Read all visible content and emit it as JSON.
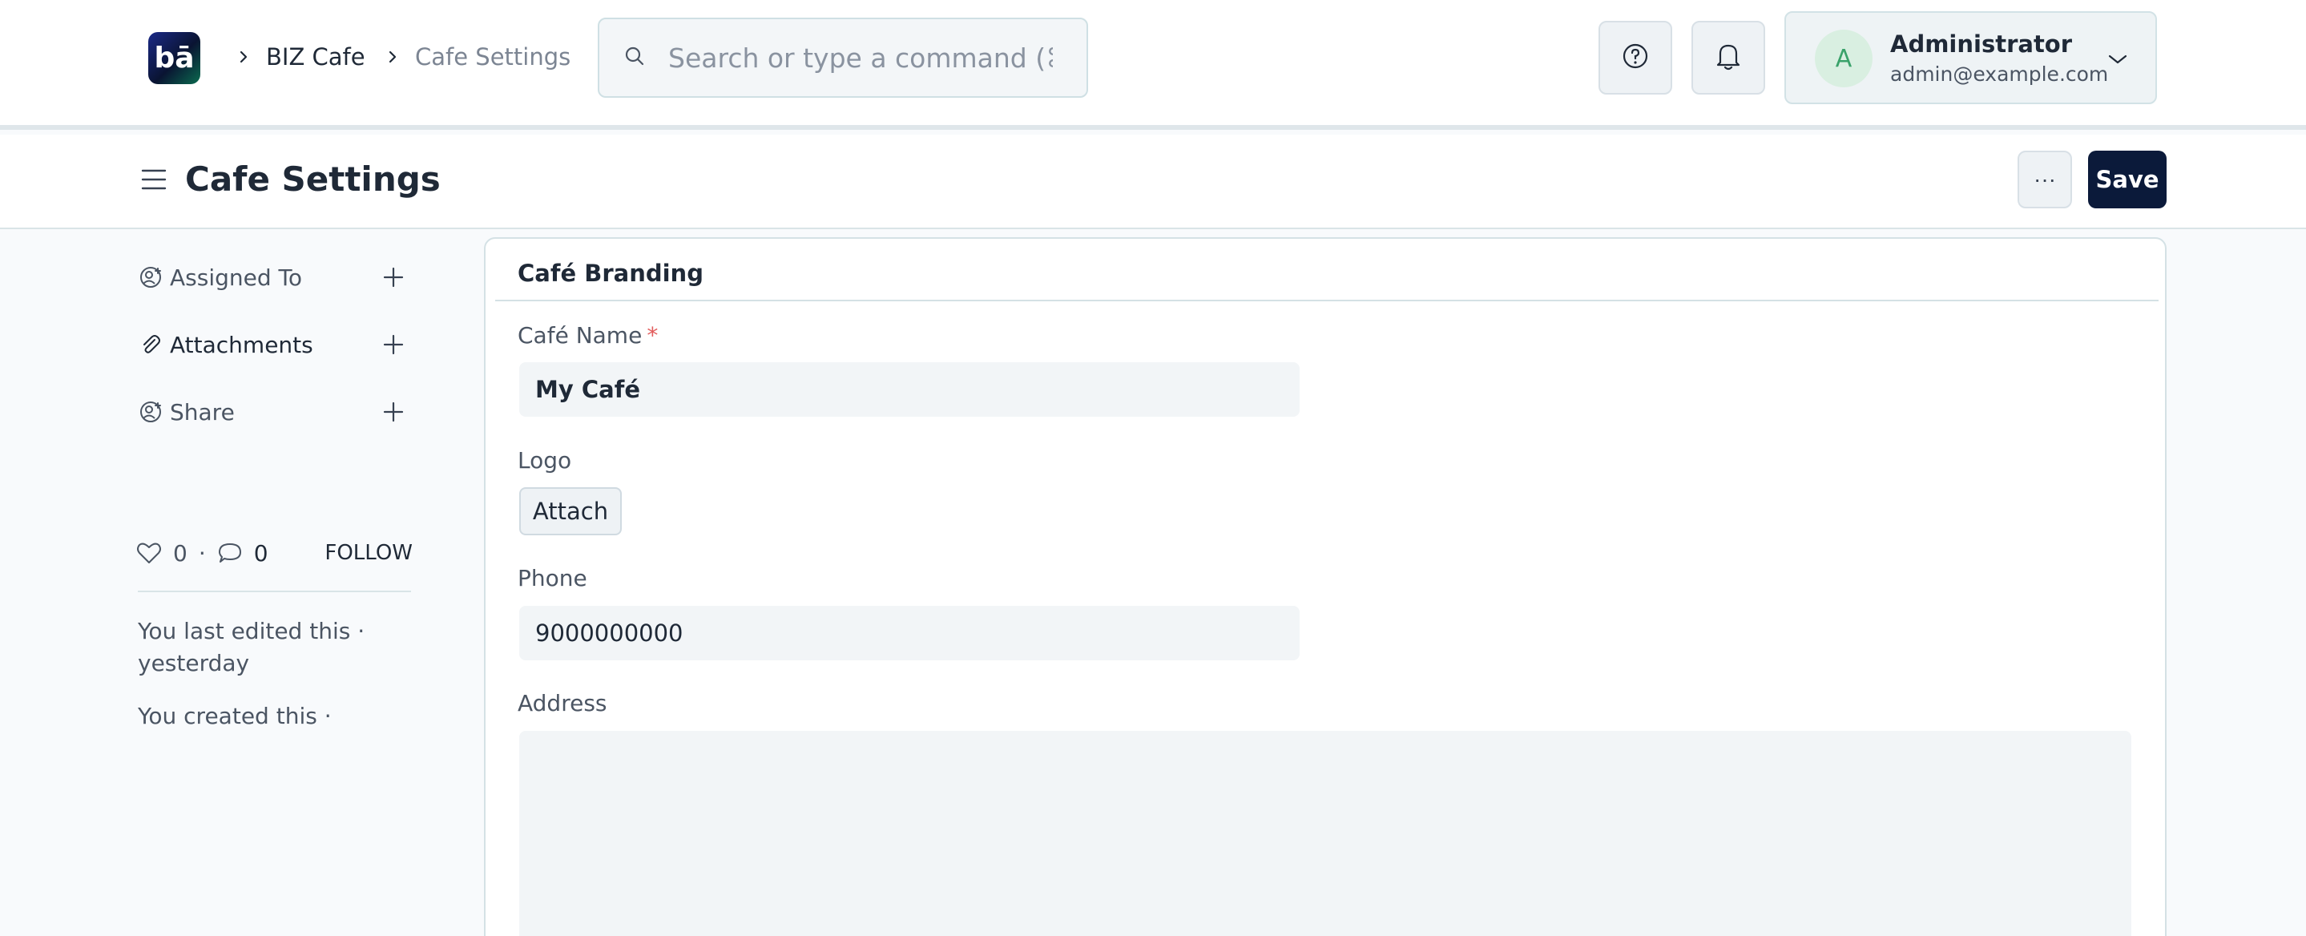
{
  "navbar": {
    "logo_text": "bā",
    "breadcrumbs": [
      "BIZ Cafe",
      "Cafe Settings"
    ],
    "search_placeholder": "Search or type a command (⌘",
    "user": {
      "initial": "A",
      "name": "Administrator",
      "email": "admin@example.com"
    }
  },
  "page": {
    "title": "Cafe Settings",
    "more_label": "···",
    "save_label": "Save"
  },
  "sidebar": {
    "items": [
      {
        "label": "Assigned To"
      },
      {
        "label": "Attachments"
      },
      {
        "label": "Share"
      }
    ],
    "likes_count": "0",
    "separator": "·",
    "comments_count": "0",
    "follow_label": "FOLLOW",
    "last_edited": "You last edited this · yesterday",
    "created": "You created this ·"
  },
  "form": {
    "section_title": "Café Branding",
    "cafe_name_label": "Café Name",
    "required_mark": "*",
    "cafe_name_value": "My Café",
    "logo_label": "Logo",
    "attach_label": "Attach",
    "phone_label": "Phone",
    "phone_value": "9000000000",
    "address_label": "Address",
    "address_value": ""
  },
  "colors": {
    "primary_button": "#0b1a3a",
    "avatar_bg": "#d9efe1",
    "avatar_text": "#3aa26a",
    "required": "#e25c5c"
  }
}
